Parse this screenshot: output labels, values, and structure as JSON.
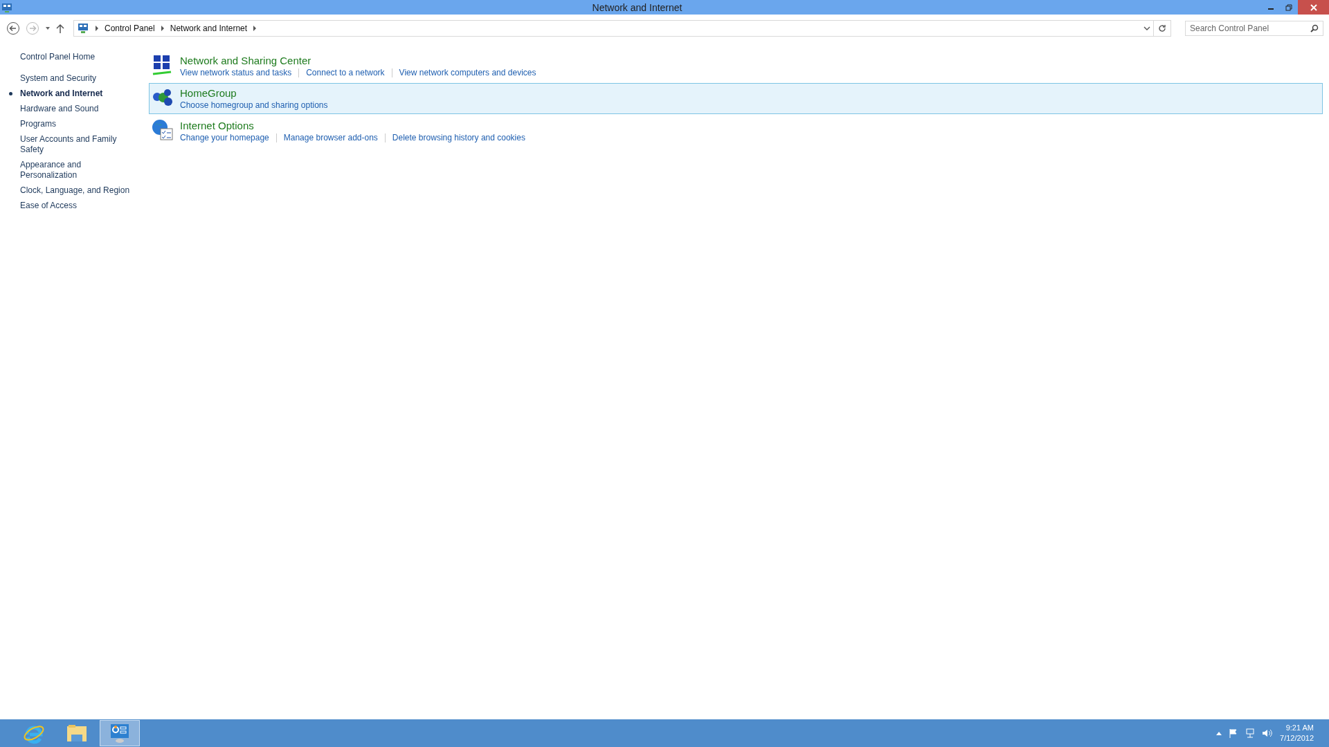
{
  "window": {
    "title": "Network and Internet"
  },
  "address_bar": {
    "breadcrumb": [
      "Control Panel",
      "Network and Internet"
    ]
  },
  "search": {
    "placeholder": "Search Control Panel"
  },
  "sidebar": {
    "home": "Control Panel Home",
    "items": [
      {
        "label": "System and Security",
        "selected": false
      },
      {
        "label": "Network and Internet",
        "selected": true
      },
      {
        "label": "Hardware and Sound",
        "selected": false
      },
      {
        "label": "Programs",
        "selected": false
      },
      {
        "label": "User Accounts and Family Safety",
        "selected": false
      },
      {
        "label": "Appearance and Personalization",
        "selected": false
      },
      {
        "label": "Clock, Language, and Region",
        "selected": false
      },
      {
        "label": "Ease of Access",
        "selected": false
      }
    ]
  },
  "categories": [
    {
      "kind": "network",
      "title": "Network and Sharing Center",
      "selected": false,
      "links": [
        "View network status and tasks",
        "Connect to a network",
        "View network computers and devices"
      ]
    },
    {
      "kind": "homegroup",
      "title": "HomeGroup",
      "selected": true,
      "links": [
        "Choose homegroup and sharing options"
      ]
    },
    {
      "kind": "internet",
      "title": "Internet Options",
      "selected": false,
      "links": [
        "Change your homepage",
        "Manage browser add-ons",
        "Delete browsing history and cookies"
      ]
    }
  ],
  "taskbar": {
    "apps": [
      {
        "kind": "browser",
        "selected": false
      },
      {
        "kind": "explorer",
        "selected": false
      },
      {
        "kind": "control",
        "selected": true
      }
    ],
    "clock": {
      "time": "9:21 AM",
      "date": "7/12/2012"
    }
  }
}
